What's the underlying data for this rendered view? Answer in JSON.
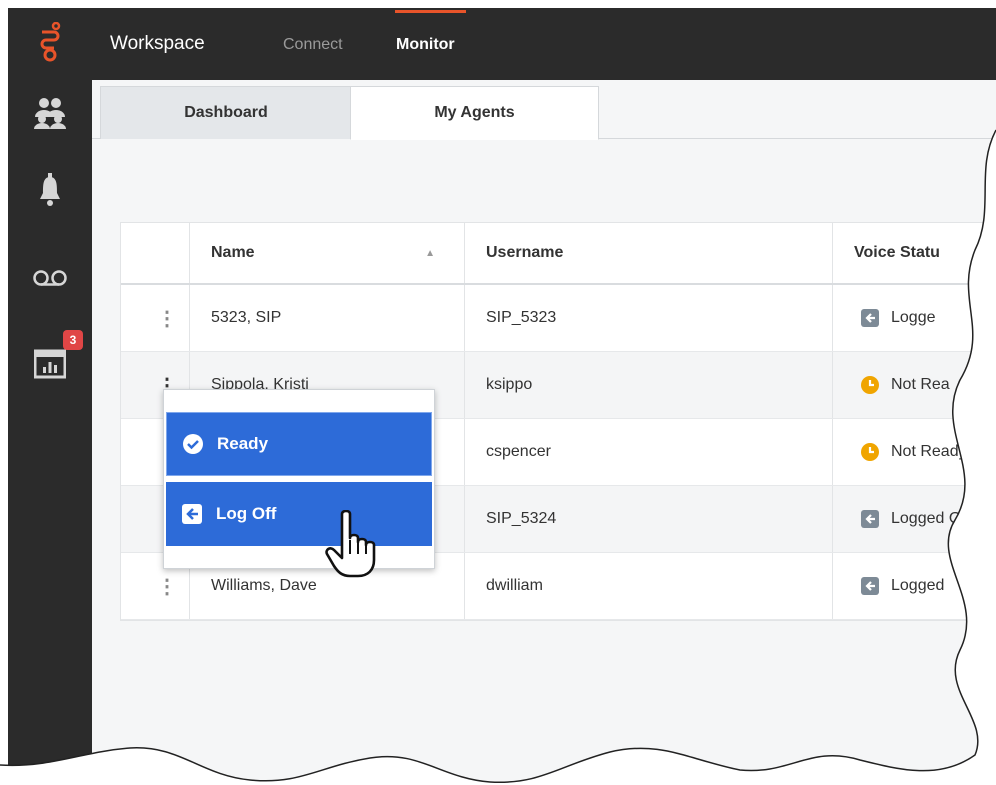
{
  "app": {
    "title": "Workspace",
    "nav": [
      {
        "label": "Connect",
        "active": false
      },
      {
        "label": "Monitor",
        "active": true
      }
    ],
    "accent_color": "#e8542a"
  },
  "sidebar": {
    "items": [
      {
        "icon": "team-icon"
      },
      {
        "icon": "bell-icon"
      },
      {
        "icon": "voicemail-icon"
      },
      {
        "icon": "dashboard-chart-icon",
        "badge": "3"
      }
    ]
  },
  "tabs": [
    {
      "label": "Dashboard",
      "active": false
    },
    {
      "label": "My Agents",
      "active": true
    }
  ],
  "table": {
    "columns": [
      "",
      "Name",
      "Username",
      "Voice Statu"
    ],
    "rows": [
      {
        "name": "5323, SIP",
        "username": "SIP_5323",
        "status": "Logge",
        "status_type": "logged-off"
      },
      {
        "name": "Sippola, Kristi",
        "username": "ksippo",
        "status": "Not Rea",
        "status_type": "not-ready"
      },
      {
        "name": "",
        "username": "cspencer",
        "status": "Not Ready",
        "status_type": "not-ready"
      },
      {
        "name": "",
        "username": "SIP_5324",
        "status": "Logged Of",
        "status_type": "logged-off"
      },
      {
        "name": "Williams, Dave",
        "username": "dwilliam",
        "status": "Logged",
        "status_type": "logged-off"
      }
    ]
  },
  "menu": {
    "items": [
      {
        "label": "Ready",
        "icon": "check-circle-icon"
      },
      {
        "label": "Log Off",
        "icon": "log-off-icon"
      }
    ],
    "highlight_color": "#2d6bd8"
  },
  "status_colors": {
    "not_ready": "#f0a500",
    "logged_off": "#7d8a96"
  }
}
